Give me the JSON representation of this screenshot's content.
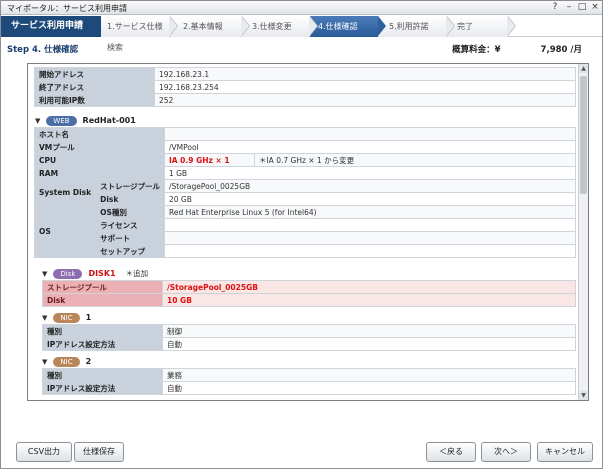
{
  "window": {
    "title": "マイポータル：サービス利用申請",
    "controls": [
      "?",
      "–",
      "□",
      "×"
    ]
  },
  "stepbar": {
    "app_name": "サービス利用申請",
    "steps": [
      "1.サービス仕様検索",
      "2.基本情報",
      "3.仕様変更",
      "4.仕様確認",
      "5.利用許諾",
      "完了"
    ],
    "active_index": 3
  },
  "header": {
    "step_title": "Step 4. 仕様確認",
    "estimate_label": "概算料金：¥",
    "estimate_value": "7,980 /月"
  },
  "network_rows": [
    {
      "label": "開始アドレス",
      "value": "192.168.23.1"
    },
    {
      "label": "終了アドレス",
      "value": "192.168.23.254"
    },
    {
      "label": "利用可能IP数",
      "value": "252"
    }
  ],
  "web": {
    "tag": "WEB",
    "name": "RedHat-001",
    "host_label": "ホスト名",
    "host_value": "",
    "pool_label": "VMプール",
    "pool_value": "/VMPool",
    "cpu_label": "CPU",
    "cpu_value": "IA 0.9 GHz × 1",
    "cpu_note": "＊IA 0.7 GHz × 1 から変更",
    "ram_label": "RAM",
    "ram_value": "1 GB",
    "sysdisk_label": "System Disk",
    "storage_label": "ストレージプール",
    "storage_value": "/StoragePool_0025GB",
    "disk_label": "Disk",
    "disk_value": "20 GB",
    "os_label": "OS",
    "os_type_label": "OS種別",
    "os_type_value": "Red Hat Enterprise Linux 5 (for Intel64)",
    "license_label": "ライセンス",
    "license_value": "",
    "support_label": "サポート",
    "support_value": "",
    "setup_label": "セットアップ",
    "setup_value": ""
  },
  "disk": {
    "tag": "Disk",
    "name": "DISK1",
    "extra": "＊追加",
    "storage_label": "ストレージプール",
    "storage_value": "/StoragePool_0025GB",
    "size_label": "Disk",
    "size_value": "10 GB"
  },
  "nics": [
    {
      "tag": "NIC",
      "index": "1",
      "type_label": "種別",
      "type_value": "制御",
      "ip_label": "IPアドレス設定方法",
      "ip_value": "自動"
    },
    {
      "tag": "NIC",
      "index": "2",
      "type_label": "種別",
      "type_value": "業務",
      "ip_label": "IPアドレス設定方法",
      "ip_value": "自動"
    }
  ],
  "footer": {
    "csv": "CSV出力",
    "save": "仕様保存",
    "back": "＜戻る",
    "next": "次へ＞",
    "cancel": "キャンセル"
  }
}
